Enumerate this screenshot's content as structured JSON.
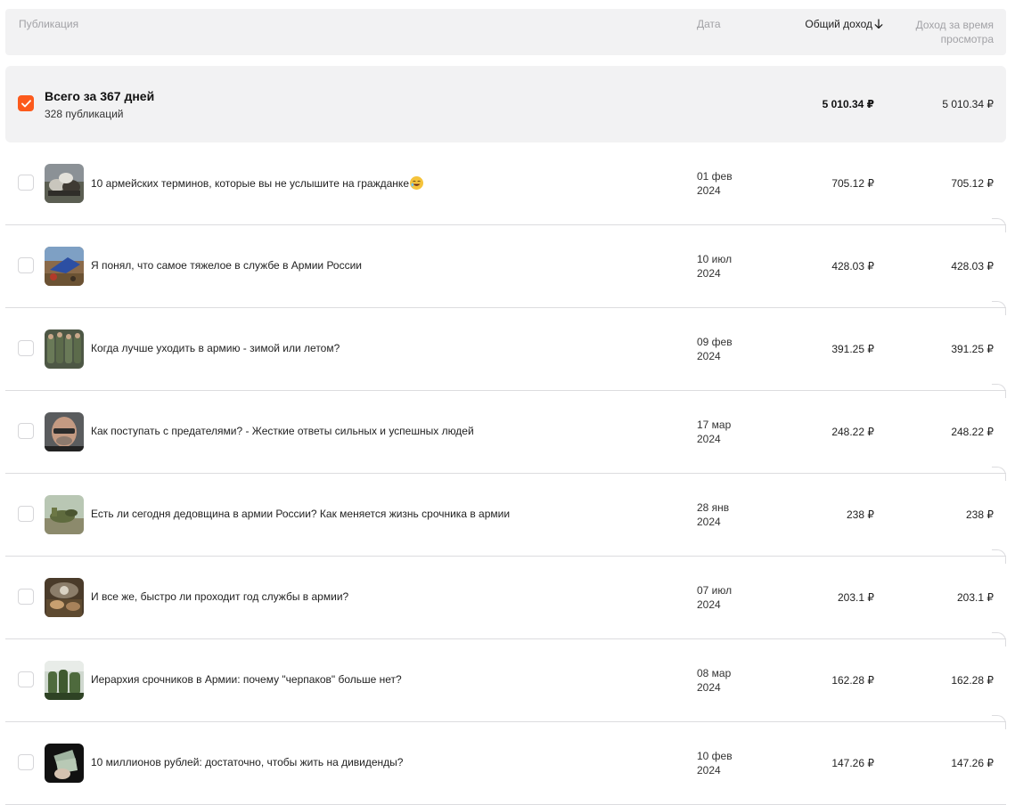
{
  "header": {
    "publication": "Публикация",
    "date": "Дата",
    "total_income": "Общий доход",
    "view_income": "Доход за время просмотра"
  },
  "summary": {
    "title": "Всего за 367 дней",
    "subtitle": "328 публикаций",
    "total": "5 010.34 ₽",
    "view": "5 010.34 ₽",
    "checked": true
  },
  "rows": [
    {
      "title": "10 армейских терминов, которые вы не услышите на гражданке",
      "emoji": "grinning-sweat-emoji",
      "date_day": "01 фев",
      "date_year": "2024",
      "total": "705.12 ₽",
      "view": "705.12 ₽"
    },
    {
      "title": "Я понял, что самое тяжелое в службе в Армии России",
      "date_day": "10 июл",
      "date_year": "2024",
      "total": "428.03 ₽",
      "view": "428.03 ₽"
    },
    {
      "title": "Когда лучше уходить в армию - зимой или летом?",
      "date_day": "09 фев",
      "date_year": "2024",
      "total": "391.25 ₽",
      "view": "391.25 ₽"
    },
    {
      "title": "Как поступать с предателями? - Жесткие ответы сильных и успешных людей",
      "date_day": "17 мар",
      "date_year": "2024",
      "total": "248.22 ₽",
      "view": "248.22 ₽"
    },
    {
      "title": "Есть ли сегодня дедовщина в армии России? Как меняется жизнь срочника в армии",
      "date_day": "28 янв",
      "date_year": "2024",
      "total": "238 ₽",
      "view": "238 ₽"
    },
    {
      "title": "И все же, быстро ли проходит год службы в армии?",
      "date_day": "07 июл",
      "date_year": "2024",
      "total": "203.1 ₽",
      "view": "203.1 ₽"
    },
    {
      "title": "Иерархия срочников в Армии: почему \"черпаков\" больше нет?",
      "date_day": "08 мар",
      "date_year": "2024",
      "total": "162.28 ₽",
      "view": "162.28 ₽"
    },
    {
      "title": "10 миллионов рублей: достаточно, чтобы жить на дивиденды?",
      "date_day": "10 фев",
      "date_year": "2024",
      "total": "147.26 ₽",
      "view": "147.26 ₽"
    }
  ],
  "colors": {
    "accent": "#fc5a1c",
    "header_bg": "#f2f2f3",
    "divider": "#dcdcdf"
  },
  "icons": {
    "sort": "arrow-down-icon",
    "check": "check-icon"
  }
}
